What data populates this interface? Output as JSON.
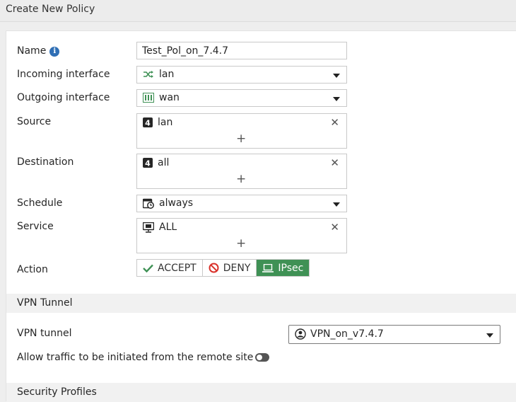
{
  "header": {
    "title": "Create New Policy"
  },
  "form": {
    "name": {
      "label": "Name",
      "value": "Test_Pol_on_7.4.7",
      "info_icon": "info-icon"
    },
    "incoming_interface": {
      "label": "Incoming interface",
      "value": "lan",
      "icon": "shuffle-icon"
    },
    "outgoing_interface": {
      "label": "Outgoing interface",
      "value": "wan",
      "icon": "network-port-icon"
    },
    "source": {
      "label": "Source",
      "entries": [
        {
          "value": "lan",
          "icon": "address-object-icon"
        }
      ],
      "add_label": "+",
      "remove_label": "✕"
    },
    "destination": {
      "label": "Destination",
      "entries": [
        {
          "value": "all",
          "icon": "address-object-icon"
        }
      ],
      "add_label": "+",
      "remove_label": "✕"
    },
    "schedule": {
      "label": "Schedule",
      "value": "always",
      "icon": "calendar-clock-icon"
    },
    "service": {
      "label": "Service",
      "entries": [
        {
          "value": "ALL",
          "icon": "service-icon"
        }
      ],
      "add_label": "+",
      "remove_label": "✕"
    },
    "action": {
      "label": "Action",
      "options": [
        {
          "label": "ACCEPT",
          "icon": "check-icon",
          "active": false
        },
        {
          "label": "DENY",
          "icon": "block-icon",
          "active": false
        },
        {
          "label": "IPsec",
          "icon": "laptop-icon",
          "active": true
        }
      ],
      "active_color": "#3f9155"
    }
  },
  "vpn_section": {
    "title": "VPN Tunnel",
    "tunnel": {
      "label": "VPN tunnel",
      "value": "VPN_on_v7.4.7",
      "icon": "vpn-user-icon"
    },
    "allow_remote": {
      "label": "Allow traffic to be initiated from the remote site",
      "enabled": false
    }
  },
  "security_section": {
    "title": "Security Profiles"
  }
}
